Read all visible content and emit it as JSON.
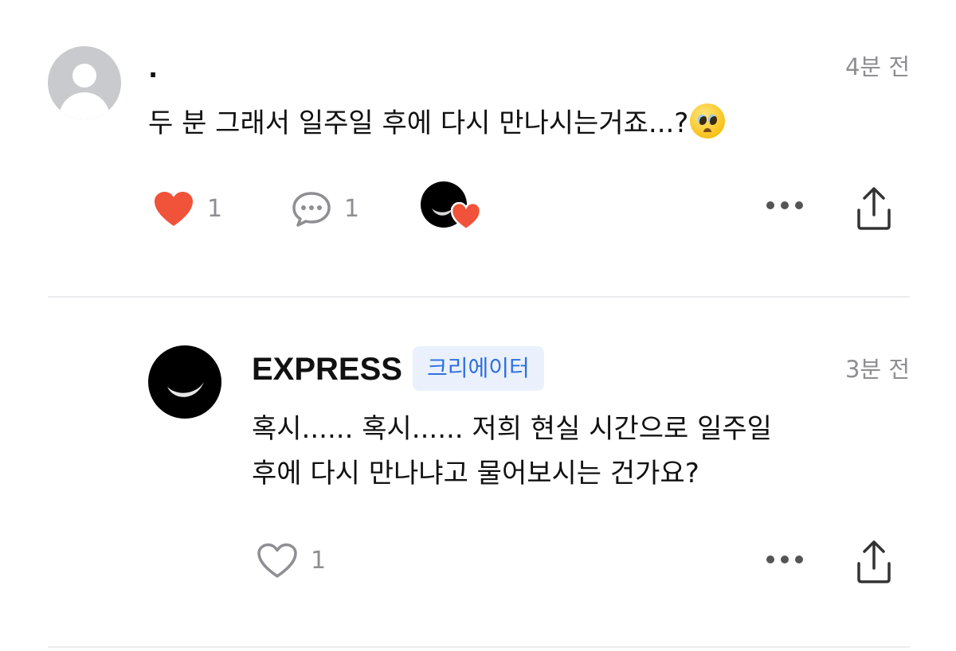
{
  "comments": [
    {
      "username": ".",
      "time": "4분 전",
      "text": "두 분 그래서 일주일 후에 다시 만나시는거죠...?",
      "emoji": "pleading-face",
      "like_count": "1",
      "liked": true,
      "reply_count": "1",
      "creator_liked": true
    },
    {
      "username": "EXPRESS",
      "badge": "크리에이터",
      "time": "3분 전",
      "text_line1": "혹시...... 혹시...... 저희 현실 시간으로 일주일",
      "text_line2": "후에 다시 만나냐고 물어보시는 건가요?",
      "like_count": "1",
      "liked": false
    }
  ],
  "colors": {
    "heart_active": "#f0533a",
    "badge_bg": "#eaf1fd",
    "badge_text": "#2f6fde",
    "muted": "#8e8e93"
  },
  "icons": {
    "like": "heart-icon",
    "reply": "speech-bubble-icon",
    "more": "more-dots-icon",
    "share": "share-icon"
  }
}
